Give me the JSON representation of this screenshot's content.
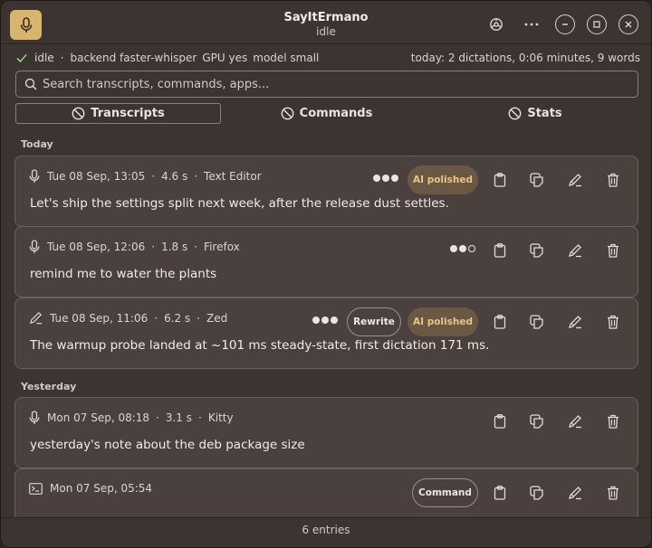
{
  "app": {
    "title": "SayItErmano",
    "state": "idle"
  },
  "status": {
    "state": "idle",
    "backend": "backend faster-whisper",
    "gpu": "GPU yes",
    "model": "model small",
    "today_summary": "today: 2 dictations, 0:06 minutes, 9 words"
  },
  "search": {
    "placeholder": "Search transcripts, commands, apps..."
  },
  "tabs": [
    {
      "label": "Transcripts",
      "active": true
    },
    {
      "label": "Commands",
      "active": false
    },
    {
      "label": "Stats",
      "active": false
    }
  ],
  "sections": {
    "today": "Today",
    "yesterday": "Yesterday"
  },
  "entries": [
    {
      "icon": "microphone-icon",
      "time": "Tue 08 Sep, 13:05",
      "duration": "4.6 s",
      "app": "Text Editor",
      "quality": 3,
      "badges": [
        "AI polished"
      ],
      "text": "Let's ship the settings split next week, after the release dust settles."
    },
    {
      "icon": "microphone-icon",
      "time": "Tue 08 Sep, 12:06",
      "duration": "1.8 s",
      "app": "Firefox",
      "quality": 2,
      "badges": [],
      "text": "remind me to water the plants"
    },
    {
      "icon": "pen-icon",
      "time": "Tue 08 Sep, 11:06",
      "duration": "6.2 s",
      "app": "Zed",
      "quality": 3,
      "badges": [
        "Rewrite",
        "AI polished"
      ],
      "text": "The warmup probe landed at ~101 ms steady-state, first dictation 171 ms."
    },
    {
      "icon": "microphone-icon",
      "time": "Mon 07 Sep, 08:18",
      "duration": "3.1 s",
      "app": "Kitty",
      "quality": null,
      "badges": [],
      "text": "yesterday's note about the deb package size"
    },
    {
      "icon": "terminal-icon",
      "time": "Mon 07 Sep, 05:54",
      "duration": "",
      "app": "",
      "quality": null,
      "badges": [
        "Command"
      ],
      "text": ""
    }
  ],
  "footer": {
    "count": "6 entries"
  },
  "colors": {
    "accent": "#d9b46c",
    "ai_badge_bg": "#6b5844",
    "ai_badge_text": "#e6c585"
  }
}
